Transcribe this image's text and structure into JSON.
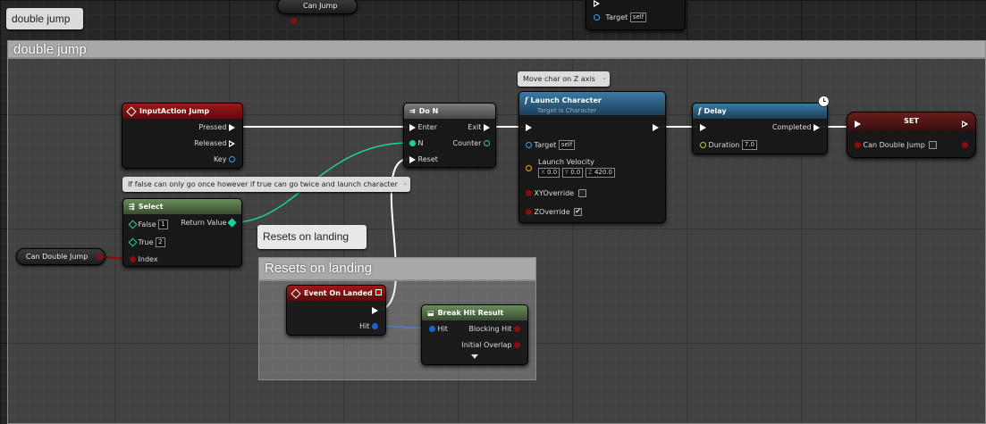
{
  "top_bubble": {
    "label": "double jump"
  },
  "comment_main": {
    "label": "double jump"
  },
  "top_var": {
    "label": "Can Jump"
  },
  "top_target": {
    "label": "Target",
    "value": "self"
  },
  "input_action": {
    "title": "InputAction Jump",
    "pins": [
      "Pressed",
      "Released",
      "Key"
    ]
  },
  "do_n": {
    "title": "Do N",
    "enter": "Enter",
    "exit": "Exit",
    "n": "N",
    "counter": "Counter",
    "reset": "Reset"
  },
  "launch_comment": {
    "label": "Move char on Z axis"
  },
  "launch": {
    "title": "Launch Character",
    "subtitle": "Target is Character",
    "target": "Target",
    "target_value": "self",
    "velocity": "Launch Velocity",
    "vx_label": "X",
    "vx": "0.0",
    "vy_label": "Y",
    "vy": "0.0",
    "vz_label": "Z",
    "vz": "420.0",
    "xy_override": "XYOverride",
    "z_override": "ZOverride"
  },
  "delay": {
    "title": "Delay",
    "completed": "Completed",
    "duration": "Duration",
    "duration_value": "7.0"
  },
  "set_node": {
    "title": "SET",
    "var": "Can Double Jump"
  },
  "select_comment": {
    "label": "If false can only go once however if true can go twice and launch character"
  },
  "select": {
    "title": "Select",
    "false_label": "False",
    "false_value": "1",
    "true_label": "True",
    "true_value": "2",
    "return": "Return Value",
    "index": "Index"
  },
  "var_can_double_jump": {
    "label": "Can Double Jump"
  },
  "resets_bubble": {
    "label": "Resets on landing"
  },
  "resets_comment": {
    "label": "Resets on landing"
  },
  "event_landed": {
    "title": "Event On Landed",
    "hit": "Hit"
  },
  "break_hit": {
    "title": "Break Hit Result",
    "hit": "Hit",
    "blocking": "Blocking Hit",
    "overlap": "Initial Overlap"
  }
}
